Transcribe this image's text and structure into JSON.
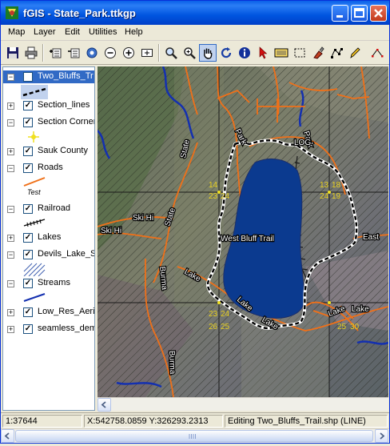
{
  "window": {
    "title": "fGIS - State_Park.ttkgp",
    "controls": [
      "minimize",
      "maximize",
      "close"
    ]
  },
  "menubar": {
    "items": [
      "Map",
      "Layer",
      "Edit",
      "Utilities",
      "Help"
    ]
  },
  "toolbar": {
    "buttons": [
      {
        "name": "save-icon"
      },
      {
        "name": "print-icon"
      },
      {
        "name": "add-layer-icon"
      },
      {
        "name": "remove-layer-icon"
      },
      {
        "name": "layer-properties-icon"
      },
      {
        "name": "zoom-out-icon"
      },
      {
        "name": "zoom-in-icon"
      },
      {
        "name": "full-extent-icon"
      },
      {
        "name": "magnify-icon"
      },
      {
        "name": "zoom-window-icon"
      },
      {
        "name": "pan-hand-icon"
      },
      {
        "name": "refresh-icon"
      },
      {
        "name": "info-icon"
      },
      {
        "name": "select-arrow-icon"
      },
      {
        "name": "select-features-icon"
      },
      {
        "name": "select-rectangle-icon"
      },
      {
        "name": "clear-selection-icon"
      },
      {
        "name": "edit-vertices-icon"
      },
      {
        "name": "pencil-icon"
      },
      {
        "name": "more-tools-icon"
      }
    ],
    "pressed": "pan-hand-icon"
  },
  "legend": {
    "layers": [
      {
        "name": "Two_Bluffs_Tr",
        "checked": true,
        "selected": true
      },
      {
        "name": "Section_lines",
        "checked": true
      },
      {
        "name": "Section Corner",
        "checked": true
      },
      {
        "name": "Sauk County",
        "checked": true
      },
      {
        "name": "Roads",
        "checked": true,
        "symbol_label": "Test"
      },
      {
        "name": "Railroad",
        "checked": true
      },
      {
        "name": "Lakes",
        "checked": true
      },
      {
        "name": "Devils_Lake_St",
        "checked": true
      },
      {
        "name": "Streams",
        "checked": true
      },
      {
        "name": "Low_Res_Aeri",
        "checked": true
      },
      {
        "name": "seamless_dem",
        "checked": true
      }
    ]
  },
  "map": {
    "labels": {
      "park_road_n": "Park",
      "park_road_ne": "Park",
      "state_road_n": "State",
      "state_road_s": "State",
      "ski_hi_1": "Ski Hi",
      "ski_hi_2": "Ski Hi",
      "burma_1": "Burma",
      "burma_2": "Burma",
      "lake_road_1": "Lake",
      "lake_road_2": "Lake",
      "lake_road_3": "Lake",
      "lake_road_4": "Lake",
      "lake_road_5": "Lake",
      "east": "East",
      "log": "LOG",
      "west_bluff_trail": "West Bluff Trail",
      "sec_14_top": "14",
      "sec_23_top": "23",
      "sec_24_top": "24",
      "sec_13_top": "13",
      "sec_18_top": "18",
      "sec_24_right": "24",
      "sec_19_right": "19",
      "sec_23_bot": "23",
      "sec_24_bot": "24",
      "sec_26_bot": "26",
      "sec_25_bot": "25",
      "sec_25_right": "25",
      "sec_30_right": "30"
    },
    "colors": {
      "lake": "#0b3a8f",
      "roads": "#f07018",
      "trail": "#000000",
      "streams": "#1430b0",
      "section_labels": "#e8d020",
      "section_lines": "#1a1a1a"
    }
  },
  "status": {
    "scale": "1:37644",
    "coords": "X:542758.0859 Y:326293.2313",
    "message": "Editing Two_Bluffs_Trail.shp (LINE)"
  }
}
